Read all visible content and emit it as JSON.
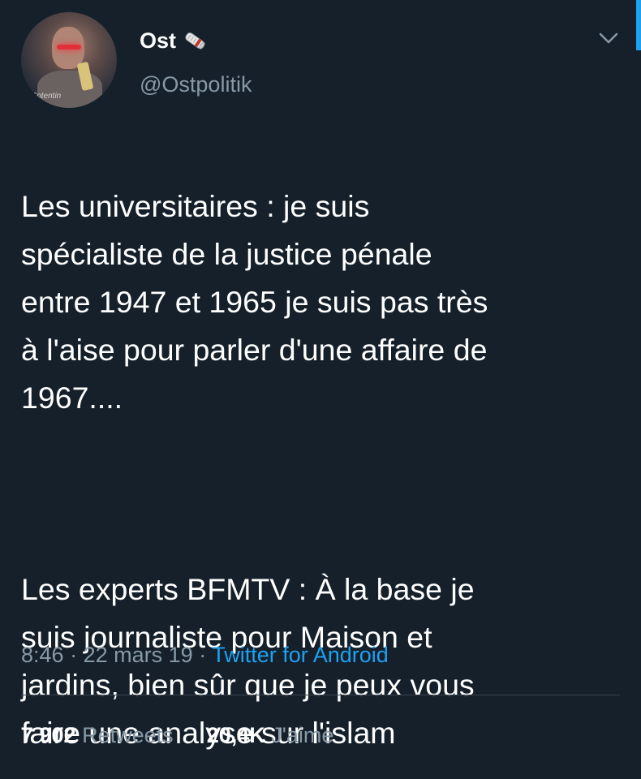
{
  "author": {
    "display_name": "Ost",
    "handle": "@Ostpolitik",
    "avatar_caption": "Cotentin",
    "name_emoji": "rolled-newspaper-icon"
  },
  "tweet": {
    "paragraph_1": "Les universitaires : je suis\nspécialiste de la justice pénale\nentre 1947 et 1965 je suis pas très\nà l'aise pour parler d'une affaire de\n1967....",
    "paragraph_2": "Les experts BFMTV : À la base je\nsuis journaliste pour Maison et\njardins, bien sûr que je peux vous\nfaire une analyse sur l'islam"
  },
  "meta": {
    "time": "8:46",
    "separator": "·",
    "date": "22 mars 19",
    "source": "Twitter for Android"
  },
  "stats": {
    "retweets_count": "7 902",
    "retweets_label": "Retweets",
    "likes_count": "20,4K",
    "likes_label": "J'aime"
  },
  "colors": {
    "background": "#15202b",
    "text_primary": "#ffffff",
    "text_secondary": "#8899a6",
    "accent": "#1da1f2",
    "divider": "#38444d"
  },
  "icons": {
    "caret": "chevron-down-icon"
  }
}
